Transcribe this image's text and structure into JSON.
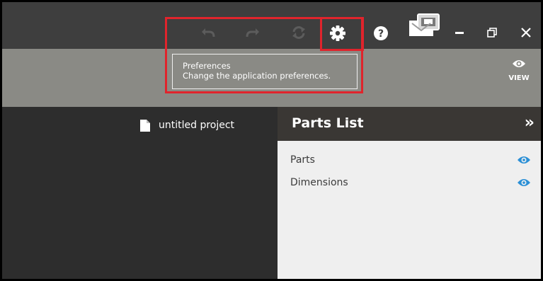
{
  "titlebar": {
    "icons": [
      "undo-icon",
      "redo-icon",
      "refresh-icon",
      "gear-icon",
      "help-icon",
      "display-mode-icon",
      "minimize-icon",
      "restore-icon",
      "close-icon"
    ]
  },
  "tooltip": {
    "title": "Preferences",
    "description": "Change the application preferences."
  },
  "ribbon": {
    "view_label": "VIEW"
  },
  "project": {
    "name": "untitled project"
  },
  "parts_list": {
    "title": "Parts List",
    "collapse_glyph": "»",
    "items": [
      {
        "label": "Parts"
      },
      {
        "label": "Dimensions"
      }
    ]
  },
  "colors": {
    "accent_blue": "#2a8fd6",
    "highlight_red": "#e0242c",
    "titlebar_bg": "#3e3e3e",
    "ribbon_bg": "#8a8a85",
    "panel_bg": "#efefef"
  }
}
